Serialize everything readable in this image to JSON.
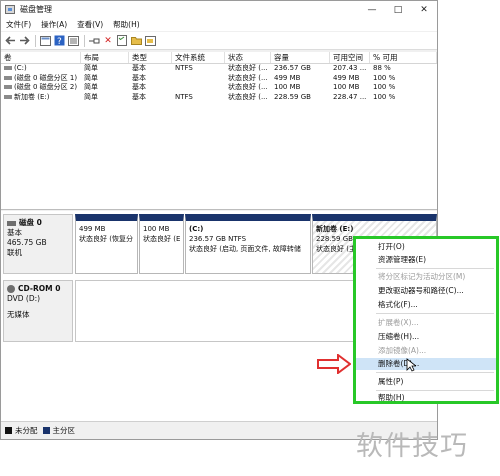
{
  "window": {
    "title": "磁盘管理",
    "buttons": [
      "—",
      "□",
      "✕"
    ]
  },
  "menubar": [
    "文件(F)",
    "操作(A)",
    "查看(V)",
    "帮助(H)"
  ],
  "toolbar": {
    "icons": [
      "back-arrow-icon",
      "forward-arrow-icon",
      "console-icon",
      "help-icon",
      "list-icon",
      "connect-icon",
      "delete-icon",
      "properties-icon",
      "folder-icon",
      "export-icon"
    ],
    "delete_glyph": "✕",
    "delete_color": "#d32020"
  },
  "volume_table": {
    "columns": [
      "卷",
      "布局",
      "类型",
      "文件系统",
      "状态",
      "容量",
      "可用空间",
      "% 可用"
    ],
    "rows": [
      [
        "(C:)",
        "简单",
        "基本",
        "NTFS",
        "状态良好 (...",
        "236.57 GB",
        "207.43 ...",
        "88 %"
      ],
      [
        "(磁盘 0 磁盘分区 1)",
        "简单",
        "基本",
        "",
        "状态良好 (...",
        "499 MB",
        "499 MB",
        "100 %"
      ],
      [
        "(磁盘 0 磁盘分区 2)",
        "简单",
        "基本",
        "",
        "状态良好 (...",
        "100 MB",
        "100 MB",
        "100 %"
      ],
      [
        "新加卷 (E:)",
        "简单",
        "基本",
        "NTFS",
        "状态良好 (...",
        "228.59 GB",
        "228.47 ...",
        "100 %"
      ]
    ]
  },
  "disk0": {
    "name": "磁盘 0",
    "type": "基本",
    "size": "465.75 GB",
    "status": "联机",
    "partitions": [
      {
        "title": "",
        "size": "499 MB",
        "status": "状态良好 (恢复分"
      },
      {
        "title": "",
        "size": "100 MB",
        "status": "状态良好 (E"
      },
      {
        "title": "(C:)",
        "size": "236.57 GB NTFS",
        "status": "状态良好 (启动, 页面文件, 故障转储"
      },
      {
        "title": "新加卷 (E:)",
        "size": "228.59 GB",
        "status": "状态良好 (主"
      }
    ]
  },
  "cdrom0": {
    "name": "CD-ROM 0",
    "drive": "DVD (D:)",
    "media": "无媒体"
  },
  "legend": {
    "unallocated": "未分配",
    "primary": "主分区",
    "unallocated_color": "#111111",
    "primary_color": "#19336b"
  },
  "context_menu": {
    "items": [
      {
        "label": "打开(O)",
        "enabled": true
      },
      {
        "label": "资源管理器(E)",
        "enabled": true
      },
      {
        "label": "将分区标记为活动分区(M)",
        "enabled": false
      },
      {
        "label": "更改驱动器号和路径(C)...",
        "enabled": true
      },
      {
        "label": "格式化(F)...",
        "enabled": true
      },
      {
        "label": "扩展卷(X)...",
        "enabled": false
      },
      {
        "label": "压缩卷(H)...",
        "enabled": true
      },
      {
        "label": "添加镜像(A)...",
        "enabled": false
      },
      {
        "label": "删除卷(D)...",
        "enabled": true,
        "highlighted": true
      },
      {
        "label": "属性(P)",
        "enabled": true
      },
      {
        "label": "帮助(H)",
        "enabled": true
      }
    ],
    "border_color": "#28c828"
  },
  "annotation_arrow_color": "#e03030",
  "watermark": "软件技巧"
}
